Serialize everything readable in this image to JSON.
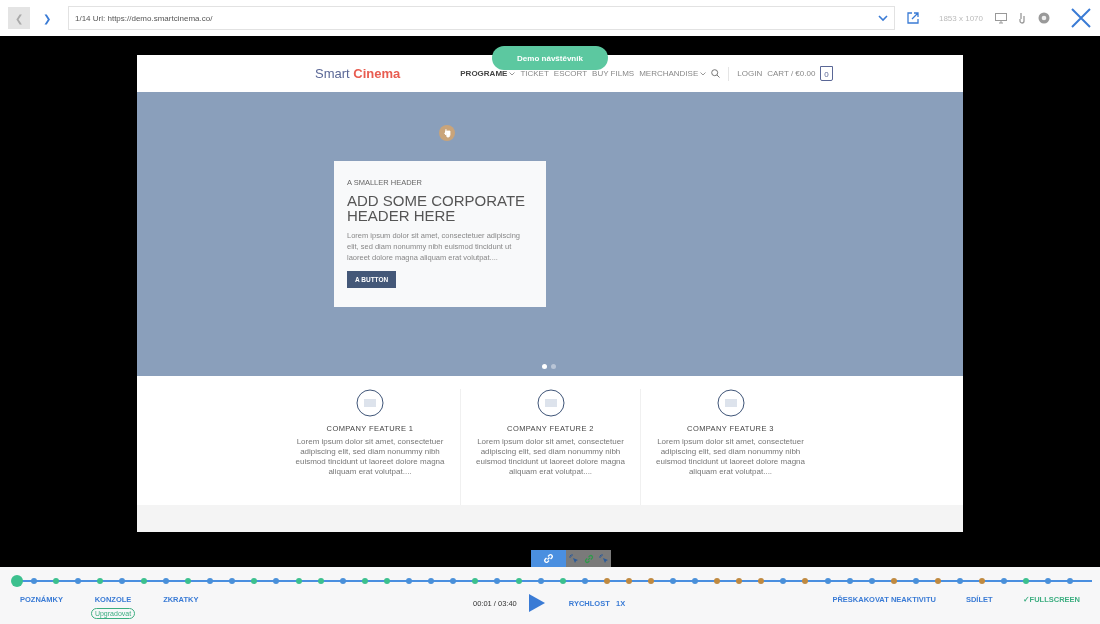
{
  "toolbar": {
    "back": {
      "label": "❮",
      "disabled": true
    },
    "forward": {
      "label": "❯",
      "disabled": false
    },
    "url_text": "1/14 Url: https://demo.smartcinema.co/",
    "resolution": "1853 x 1070"
  },
  "visitor_badge": "Demo návštěvník",
  "site": {
    "logo": {
      "first": "Smart",
      "second": "Cinema"
    },
    "nav": [
      {
        "label": "PROGRAME",
        "dropdown": true,
        "selected": true
      },
      {
        "label": "TICKET",
        "dropdown": false,
        "selected": false
      },
      {
        "label": "ESCORT",
        "dropdown": false,
        "selected": false
      },
      {
        "label": "BUY FILMS",
        "dropdown": false,
        "selected": false
      },
      {
        "label": "MERCHANDISE",
        "dropdown": true,
        "selected": false
      }
    ],
    "login": "LOGIN",
    "cart": "CART / €0.00",
    "cart_count": "0",
    "hero": {
      "kicker": "A SMALLER HEADER",
      "title": "ADD SOME CORPORATE HEADER HERE",
      "text": "Lorem ipsum dolor sit amet, consectetuer adipiscing elit, sed diam nonummy nibh euismod tincidunt ut laoreet dolore magna aliquam erat volutpat....",
      "button": "A BUTTON",
      "slides": [
        {
          "selected": true
        },
        {
          "selected": false
        }
      ]
    },
    "features": [
      {
        "title": "COMPANY FEATURE 1",
        "text": "Lorem ipsum dolor sit amet, consectetuer adipiscing elit, sed diam nonummy nibh euismod tincidunt ut laoreet dolore magna aliquam erat volutpat...."
      },
      {
        "title": "COMPANY FEATURE 2",
        "text": "Lorem ipsum dolor sit amet, consectetuer adipiscing elit, sed diam nonummy nibh euismod tincidunt ut laoreet dolore magna aliquam erat volutpat...."
      },
      {
        "title": "COMPANY FEATURE 3",
        "text": "Lorem ipsum dolor sit amet, consectetuer adipiscing elit, sed diam nonummy nibh euismod tincidunt ut laoreet dolore magna aliquam erat volutpat...."
      }
    ]
  },
  "player": {
    "level": 0.005,
    "markers": [
      {
        "color": "#4a90d9"
      },
      {
        "color": "#3cc08e"
      },
      {
        "color": "#4a90d9"
      },
      {
        "color": "#3cc08e"
      },
      {
        "color": "#4a90d9"
      },
      {
        "color": "#3cc08e"
      },
      {
        "color": "#4a90d9"
      },
      {
        "color": "#3cc08e"
      },
      {
        "color": "#4a90d9"
      },
      {
        "color": "#4a90d9"
      },
      {
        "color": "#3cc08e"
      },
      {
        "color": "#4a90d9"
      },
      {
        "color": "#3cc08e"
      },
      {
        "color": "#3cc08e"
      },
      {
        "color": "#4a90d9"
      },
      {
        "color": "#3cc08e"
      },
      {
        "color": "#3cc08e"
      },
      {
        "color": "#4a90d9"
      },
      {
        "color": "#4a90d9"
      },
      {
        "color": "#4a90d9"
      },
      {
        "color": "#3cc08e"
      },
      {
        "color": "#4a90d9"
      },
      {
        "color": "#3cc08e"
      },
      {
        "color": "#4a90d9"
      },
      {
        "color": "#3cc08e"
      },
      {
        "color": "#4a90d9"
      },
      {
        "color": "#c08a40"
      },
      {
        "color": "#c08a40"
      },
      {
        "color": "#c08a40"
      },
      {
        "color": "#4a90d9"
      },
      {
        "color": "#4a90d9"
      },
      {
        "color": "#c08a40"
      },
      {
        "color": "#c08a40"
      },
      {
        "color": "#c08a40"
      },
      {
        "color": "#4a90d9"
      },
      {
        "color": "#c08a40"
      },
      {
        "color": "#4a90d9"
      },
      {
        "color": "#4a90d9"
      },
      {
        "color": "#4a90d9"
      },
      {
        "color": "#c08a40"
      },
      {
        "color": "#4a90d9"
      },
      {
        "color": "#c08a40"
      },
      {
        "color": "#4a90d9"
      },
      {
        "color": "#c08a40"
      },
      {
        "color": "#4a90d9"
      },
      {
        "color": "#3cc08e"
      },
      {
        "color": "#4a90d9"
      },
      {
        "color": "#4a90d9"
      }
    ],
    "left_links": [
      {
        "label": "POZNÁMKY"
      },
      {
        "label": "KONZOLE",
        "badge": "Upgradovat"
      },
      {
        "label": "ZKRATKY"
      }
    ],
    "time": "00:01 / 03:40",
    "speed": "RYCHLOST   1X",
    "right_links": [
      {
        "label": "PŘESKAKOVAT NEAKTIVITU",
        "checked": false
      },
      {
        "label": "SDÍLET",
        "checked": false
      },
      {
        "label": "FULLSCREEN",
        "checked": true,
        "check": "✓"
      }
    ]
  }
}
